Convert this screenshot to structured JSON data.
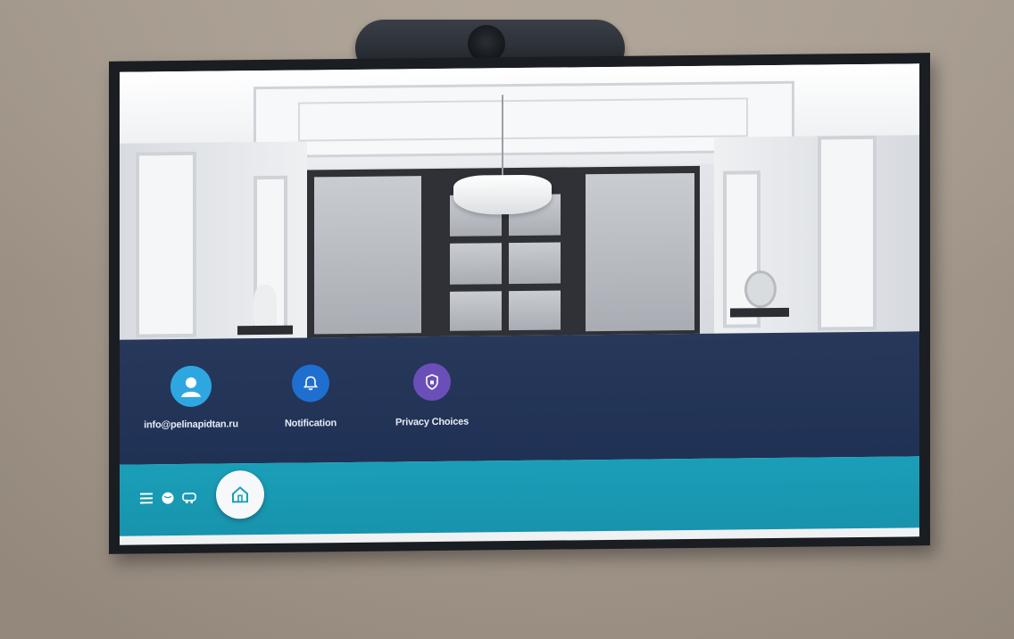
{
  "menu": {
    "items": [
      {
        "label": "info@pelinapidtan.ru",
        "icon": "user-icon",
        "color": "#2ea7e0"
      },
      {
        "label": "Notification",
        "icon": "bell-icon",
        "color": "#1f6fd1"
      },
      {
        "label": "Privacy Choices",
        "icon": "shield-icon",
        "color": "#6b4fb8"
      }
    ]
  },
  "navbar": {
    "icons": [
      "menu-icon",
      "globe-icon",
      "gamepad-icon"
    ],
    "home_icon": "home-icon",
    "accent": "#1a9fb8"
  },
  "colors": {
    "panel": "#24365a",
    "navbar": "#1a9fb8"
  }
}
